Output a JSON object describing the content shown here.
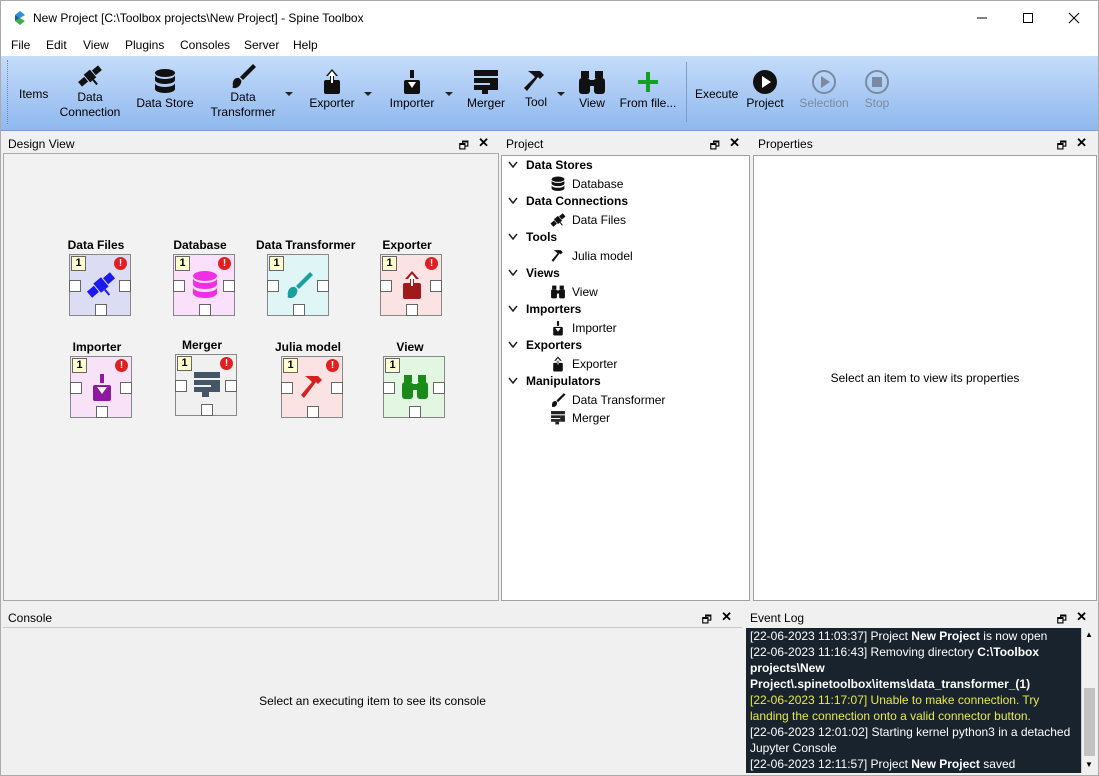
{
  "window": {
    "title": "New Project [C:\\Toolbox projects\\New Project] - Spine Toolbox"
  },
  "menu": [
    "File",
    "Edit",
    "View",
    "Plugins",
    "Consoles",
    "Server",
    "Help"
  ],
  "toolbar": {
    "items_label": "Items",
    "data_connection": "Data\nConnection",
    "data_connection_l1": "Data",
    "data_connection_l2": "Connection",
    "data_store": "Data Store",
    "data_transformer_l1": "Data",
    "data_transformer_l2": "Transformer",
    "exporter": "Exporter",
    "importer": "Importer",
    "merger": "Merger",
    "tool": "Tool",
    "view": "View",
    "from_file": "From file...",
    "execute_label": "Execute",
    "project": "Project",
    "selection": "Selection",
    "stop": "Stop"
  },
  "design_view": {
    "title": "Design View",
    "items": [
      {
        "name": "Data Files",
        "color": "#dcdcf5",
        "warn": true
      },
      {
        "name": "Database",
        "color": "#fbe0fb",
        "warn": true
      },
      {
        "name": "Data Transformer",
        "color": "#e0f5f5",
        "warn": false
      },
      {
        "name": "Exporter",
        "color": "#fbe3e3",
        "warn": true
      },
      {
        "name": "Importer",
        "color": "#f8e2f8",
        "warn": true
      },
      {
        "name": "Merger",
        "color": "#f0f0f0",
        "warn": true
      },
      {
        "name": "Julia model",
        "color": "#fbe3e3",
        "warn": true
      },
      {
        "name": "View",
        "color": "#e2f6e2",
        "warn": false
      }
    ],
    "badge": "1",
    "warn_glyph": "!"
  },
  "project": {
    "title": "Project",
    "tree": [
      {
        "category": "Data Stores",
        "items": [
          "Database"
        ]
      },
      {
        "category": "Data Connections",
        "items": [
          "Data Files"
        ]
      },
      {
        "category": "Tools",
        "items": [
          "Julia model"
        ]
      },
      {
        "category": "Views",
        "items": [
          "View"
        ]
      },
      {
        "category": "Importers",
        "items": [
          "Importer"
        ]
      },
      {
        "category": "Exporters",
        "items": [
          "Exporter"
        ]
      },
      {
        "category": "Manipulators",
        "items": [
          "Data Transformer",
          "Merger"
        ]
      }
    ]
  },
  "properties": {
    "title": "Properties",
    "placeholder": "Select an item to view its properties"
  },
  "console": {
    "title": "Console",
    "placeholder": "Select an executing item to see its console"
  },
  "event_log": {
    "title": "Event Log",
    "entries": [
      {
        "ts": "[22-06-2023 11:03:37]",
        "pre": " Project ",
        "bold": "New Project",
        "post": " is now open",
        "warn": false
      },
      {
        "ts": "[22-06-2023 11:16:43]",
        "pre": " Removing directory ",
        "bold": "C:\\Toolbox projects\\New Project\\.spinetoolbox\\items\\data_transformer_(1)",
        "post": "",
        "warn": false
      },
      {
        "ts": "[22-06-2023 11:17:07]",
        "pre": " Unable to make connection. Try landing the connection onto a valid connector button.",
        "bold": "",
        "post": "",
        "warn": true
      },
      {
        "ts": "[22-06-2023 12:01:02]",
        "pre": " Starting kernel python3 in a detached Jupyter Console",
        "bold": "",
        "post": "",
        "warn": false
      },
      {
        "ts": "[22-06-2023 12:11:57]",
        "pre": " Project ",
        "bold": "New Project",
        "post": " saved",
        "warn": false
      }
    ]
  }
}
